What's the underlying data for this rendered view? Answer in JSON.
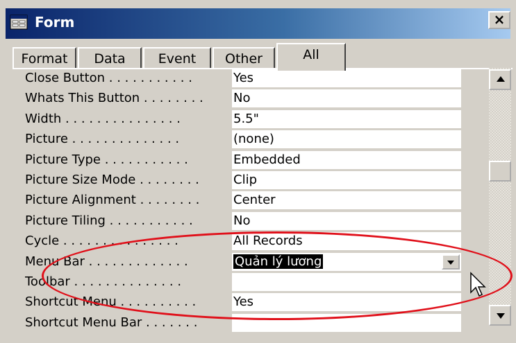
{
  "window": {
    "title": "Form",
    "close_label": "×"
  },
  "tabs": [
    {
      "label": "Format"
    },
    {
      "label": "Data"
    },
    {
      "label": "Event"
    },
    {
      "label": "Other"
    },
    {
      "label": "All",
      "active": true
    }
  ],
  "properties": [
    {
      "label": "Close Button",
      "dots": " . . . . . . . . . . .",
      "value": "Yes"
    },
    {
      "label": "Whats This Button",
      "dots": " . . . . . . . .",
      "value": "No"
    },
    {
      "label": "Width",
      "dots": " . . . . . . . . . . . . . . .",
      "value": "5.5\""
    },
    {
      "label": "Picture",
      "dots": " . . . . . . . . . . . . . .",
      "value": "(none)"
    },
    {
      "label": "Picture Type",
      "dots": " . . . . . . . . . . .",
      "value": "Embedded"
    },
    {
      "label": "Picture Size Mode",
      "dots": " . . . . . . . .",
      "value": "Clip"
    },
    {
      "label": "Picture Alignment",
      "dots": " . . . . . . . .",
      "value": "Center"
    },
    {
      "label": "Picture Tiling",
      "dots": " . . . . . . . . . . .",
      "value": "No"
    },
    {
      "label": "Cycle",
      "dots": " . . . . . . . . . . . . . . .",
      "value": "All Records"
    },
    {
      "label": "Menu Bar",
      "dots": " . . . . . . . . . . . . .",
      "value": "Quản lý lương",
      "selected": true,
      "dropdown": true
    },
    {
      "label": "Toolbar",
      "dots": " . . . . . . . . . . . . . .",
      "value": ""
    },
    {
      "label": "Shortcut Menu",
      "dots": " . . . . . . . . . .",
      "value": "Yes"
    },
    {
      "label": "Shortcut Menu Bar",
      "dots": " . . . . . . .",
      "value": ""
    }
  ],
  "colors": {
    "highlight_ellipse": "#e0101a",
    "titlebar_start": "#0a246a",
    "titlebar_end": "#a6caf0"
  }
}
